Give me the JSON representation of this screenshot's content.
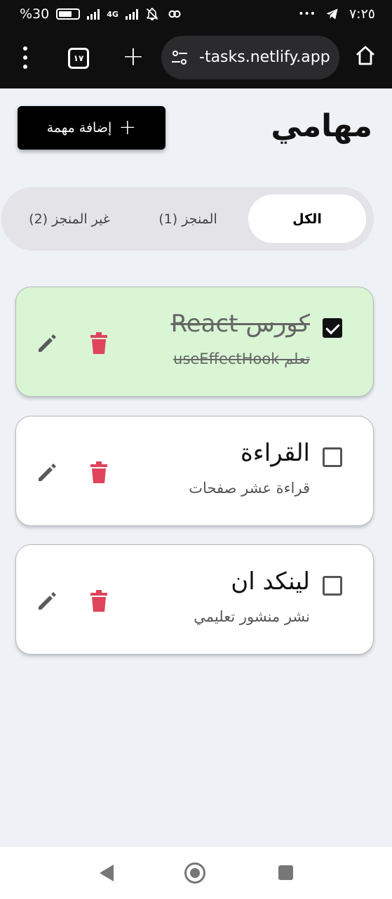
{
  "status_bar": {
    "battery": "%30",
    "network": "4G",
    "more": "•••",
    "time": "٧:٢٥"
  },
  "browser": {
    "tab_count": "١٧",
    "new_tab": "+",
    "url": "-tasks.netlify.app"
  },
  "header": {
    "title": "مهامي",
    "add_button_label": "إضافة مهمة",
    "add_button_icon": "+"
  },
  "filters": [
    {
      "label": "الكل",
      "active": true
    },
    {
      "label": "المنجز (1)",
      "active": false
    },
    {
      "label": "غير المنجز (2)",
      "active": false
    }
  ],
  "tasks": [
    {
      "title": "كورس React",
      "description": "تعلم useEffectHook",
      "done": true
    },
    {
      "title": "القراءة",
      "description": "قراءة عشر صفحات",
      "done": false
    },
    {
      "title": "لينكد ان",
      "description": "نشر منشور تعليمي",
      "done": false
    }
  ],
  "colors": {
    "done_card": "#d9f5d4",
    "delete_icon": "#e0445a",
    "edit_icon": "#5a5a5a",
    "page_background": "#eef2f7"
  }
}
